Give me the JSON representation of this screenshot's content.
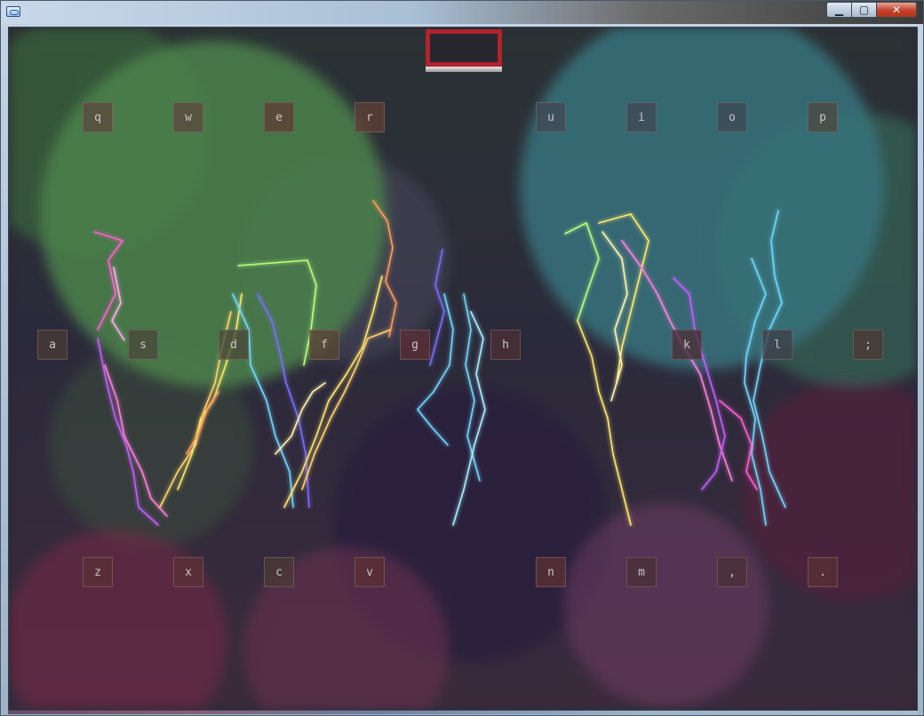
{
  "window": {
    "title": "",
    "caption_buttons": {
      "minimize": "▁",
      "maximize": "▢",
      "close": "✕"
    }
  },
  "keyboard": {
    "row1": [
      {
        "label": "q",
        "color": "#5a4a3e"
      },
      {
        "label": "w",
        "color": "#5a4a3e"
      },
      {
        "label": "e",
        "color": "#5e3f36"
      },
      {
        "label": "r",
        "color": "#5e3f36"
      },
      {
        "label": "u",
        "color": "#3f4a55"
      },
      {
        "label": "i",
        "color": "#3f4a55"
      },
      {
        "label": "o",
        "color": "#3f4a55"
      },
      {
        "label": "p",
        "color": "#4b4a40"
      }
    ],
    "row2": [
      {
        "label": "a",
        "color": "#4a3a36"
      },
      {
        "label": "s",
        "color": "#4a4a3a"
      },
      {
        "label": "d",
        "color": "#4a4a3a"
      },
      {
        "label": "f",
        "color": "#5a4636"
      },
      {
        "label": "g",
        "color": "#5a2f36"
      },
      {
        "label": "h",
        "color": "#4a2f36"
      },
      {
        "label": "k",
        "color": "#4a2f3a"
      },
      {
        "label": "l",
        "color": "#3f3f4a"
      },
      {
        "label": ";",
        "color": "#4a3a34"
      }
    ],
    "row3": [
      {
        "label": "z",
        "color": "#5a2f36"
      },
      {
        "label": "x",
        "color": "#5a2f36"
      },
      {
        "label": "c",
        "color": "#4a3a36"
      },
      {
        "label": "v",
        "color": "#5a2f36"
      },
      {
        "label": "n",
        "color": "#5a2f36"
      },
      {
        "label": "m",
        "color": "#4a2f3a"
      },
      {
        "label": ",",
        "color": "#4a2f3a"
      },
      {
        "label": ".",
        "color": "#5a2f36"
      }
    ]
  },
  "colors": {
    "lightning": [
      "#ff5fd0",
      "#ffe86a",
      "#6fd8ff",
      "#7a6cff",
      "#b7ff7a",
      "#ff9a5a",
      "#c45cff"
    ],
    "top_indicator": "#b0232e"
  },
  "icons": {
    "app": "app-window-icon"
  }
}
